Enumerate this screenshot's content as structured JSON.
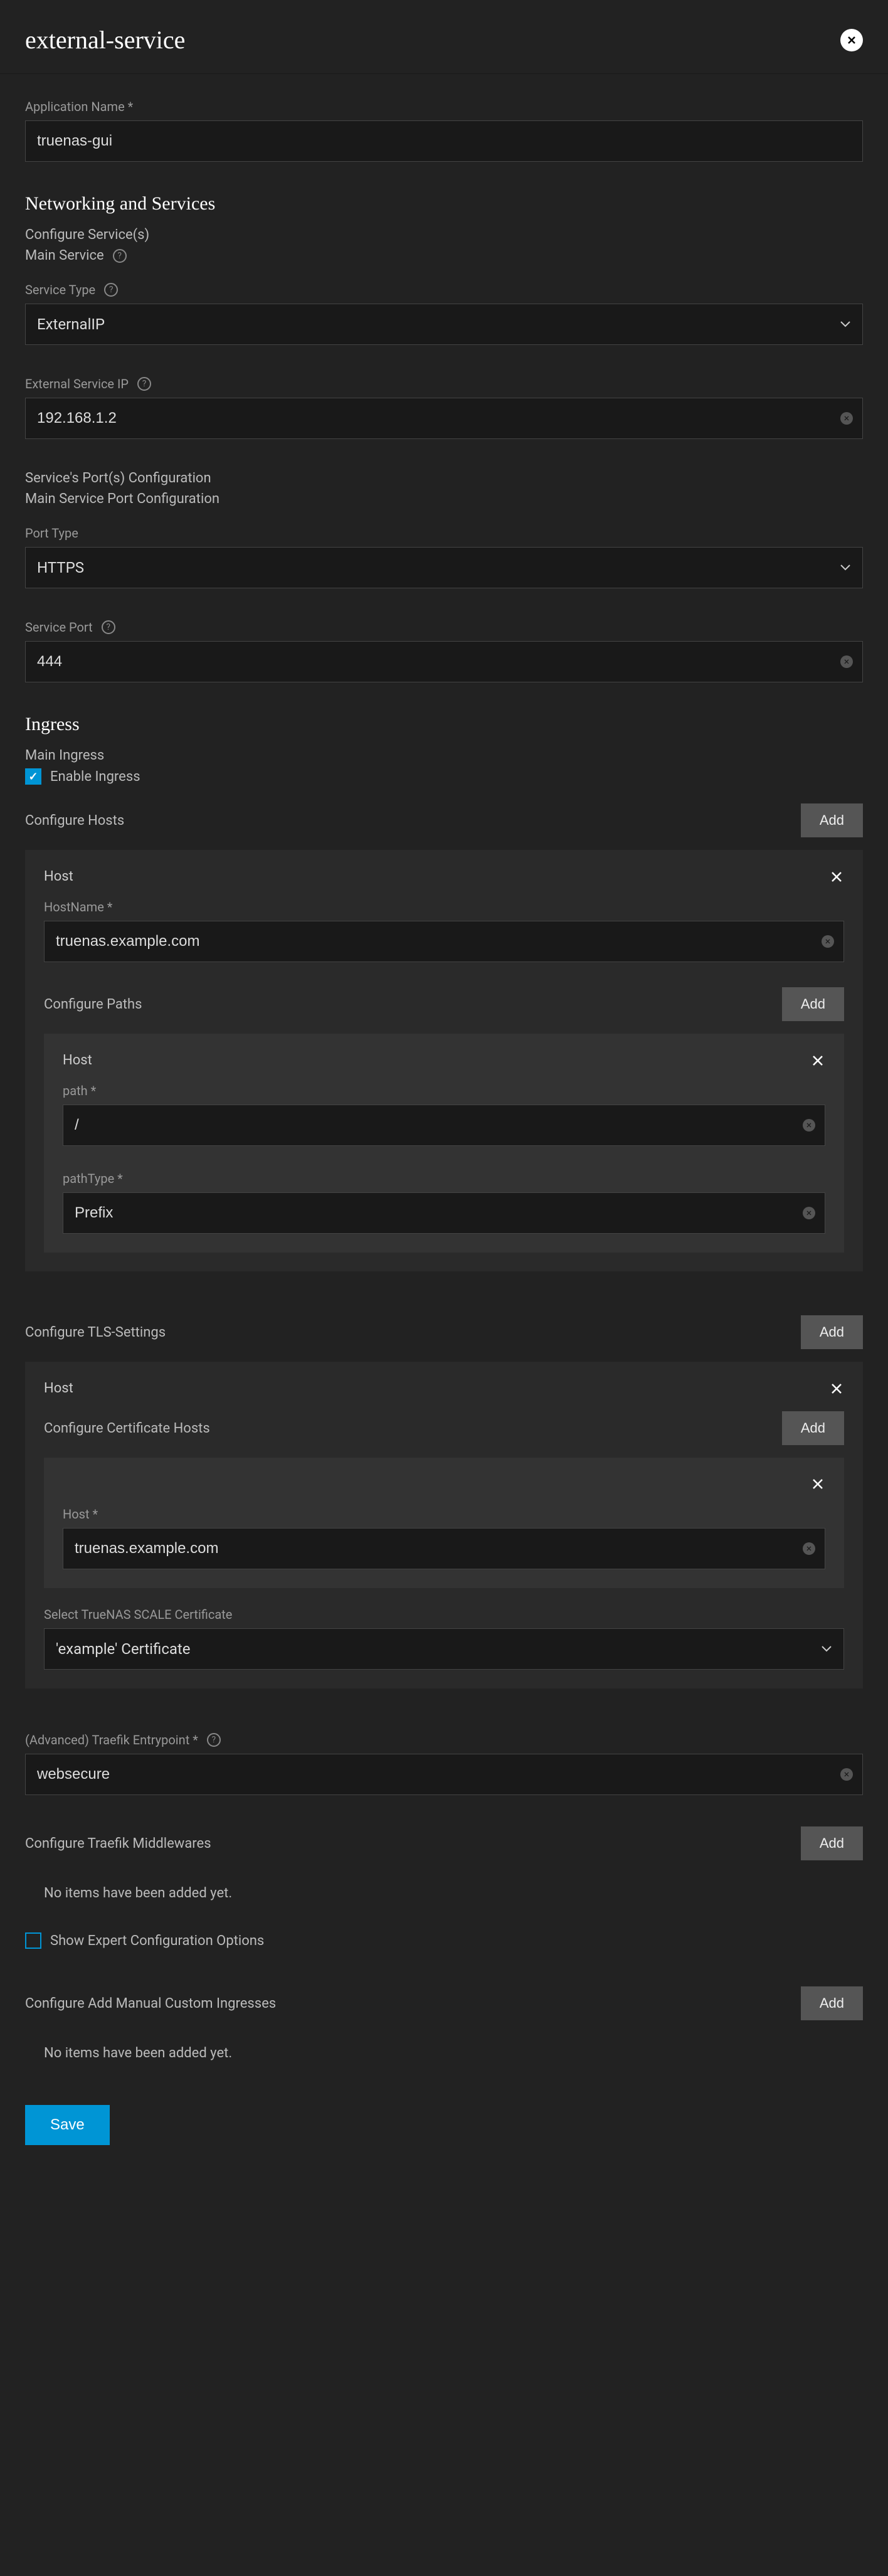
{
  "header": {
    "title": "external-service"
  },
  "appName": {
    "label": "Application Name *",
    "value": "truenas-gui"
  },
  "networking": {
    "title": "Networking and Services",
    "configureServices": "Configure Service(s)",
    "mainService": "Main Service",
    "serviceType": {
      "label": "Service Type",
      "value": "ExternalIP"
    },
    "externalIP": {
      "label": "External Service IP",
      "value": "192.168.1.2"
    },
    "portsConfig": "Service's Port(s) Configuration",
    "mainPortConfig": "Main Service Port Configuration",
    "portType": {
      "label": "Port Type",
      "value": "HTTPS"
    },
    "servicePort": {
      "label": "Service Port",
      "value": "444"
    }
  },
  "ingress": {
    "title": "Ingress",
    "mainIngress": "Main Ingress",
    "enableIngress": "Enable Ingress",
    "configureHosts": "Configure Hosts",
    "host": {
      "title": "Host",
      "hostname": {
        "label": "HostName *",
        "value": "truenas.example.com"
      },
      "configurePaths": "Configure Paths",
      "pathsHost": "Host",
      "path": {
        "label": "path *",
        "value": "/"
      },
      "pathType": {
        "label": "pathType *",
        "value": "Prefix"
      }
    },
    "tls": {
      "configureTLS": "Configure TLS-Settings",
      "host": "Host",
      "configureCertHosts": "Configure Certificate Hosts",
      "certHost": {
        "label": "Host *",
        "value": "truenas.example.com"
      },
      "selectCert": {
        "label": "Select TrueNAS SCALE Certificate",
        "value": "'example' Certificate"
      }
    },
    "traefik": {
      "entrypoint": {
        "label": "(Advanced) Traefik Entrypoint *",
        "value": "websecure"
      },
      "middlewares": "Configure Traefik Middlewares",
      "noItems": "No items have been added yet."
    },
    "expert": "Show Expert Configuration Options",
    "customIngresses": {
      "label": "Configure Add Manual Custom Ingresses",
      "noItems": "No items have been added yet."
    }
  },
  "buttons": {
    "add": "Add",
    "save": "Save"
  }
}
